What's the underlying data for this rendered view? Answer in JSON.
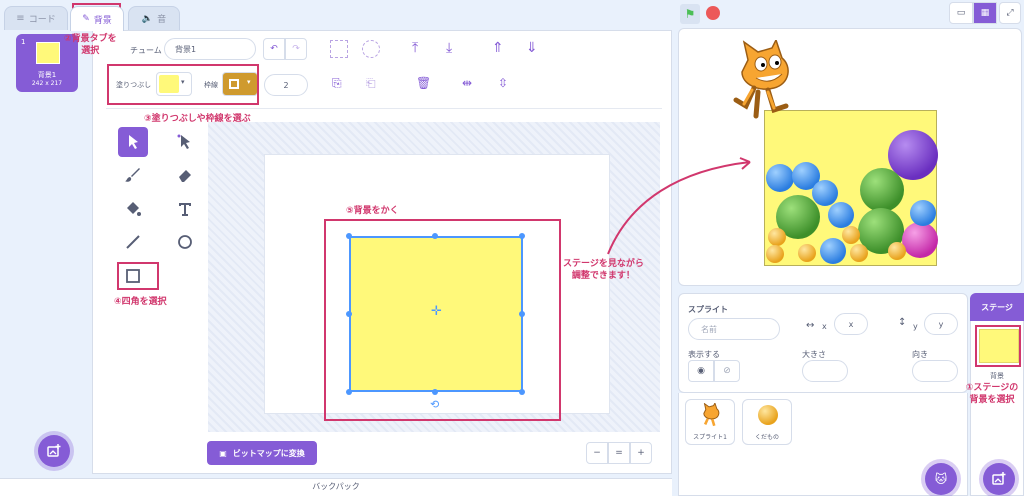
{
  "tabs": {
    "code": "コード",
    "costumes": "背景",
    "sounds": "音"
  },
  "costume_list": {
    "index": "1",
    "name": "背景1",
    "size": "242 x 217"
  },
  "editor": {
    "name_label": "チューム",
    "name_value": "背景1",
    "fill_label": "塗りつぶし",
    "outline_label": "枠線",
    "outline_width": "2",
    "convert_button": "ビットマップに変換"
  },
  "zoom": {
    "out": "−",
    "reset": "=",
    "in": "+"
  },
  "backpack": "バックパック",
  "sprite_info": {
    "sprite_label": "スプライト",
    "name_placeholder": "名前",
    "x_label": "x",
    "x_value": "x",
    "y_label": "y",
    "y_value": "y",
    "show_label": "表示する",
    "size_label": "大きさ",
    "direction_label": "向き"
  },
  "sprites": [
    {
      "name": "スプライト1"
    },
    {
      "name": "くだもの"
    }
  ],
  "stage_panel": {
    "header": "ステージ",
    "backdrop_label": "背景"
  },
  "annotations": {
    "a1_line1": "①ステージの",
    "a1_line2": "背景を選択",
    "a2_line1": "②背景タブを",
    "a2_line2": "選択",
    "a3": "③塗りつぶしや枠線を選ぶ",
    "a4": "④四角を選択",
    "a5": "⑤背景をかく",
    "note_line1": "ステージを見ながら",
    "note_line2": "調整できます！"
  },
  "colors": {
    "accent": "#855cd6",
    "fill": "#fff97a",
    "outline": "#cf9a2e",
    "annotation": "#d1376d",
    "selection": "#4c97ff"
  }
}
